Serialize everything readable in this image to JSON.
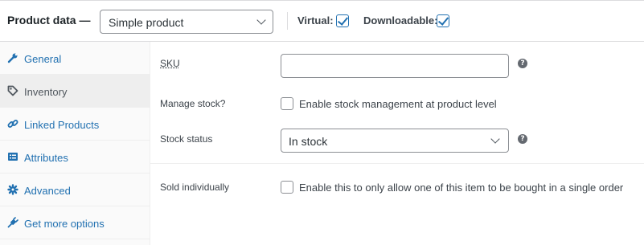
{
  "header": {
    "title": "Product data —",
    "product_type": {
      "selected": "Simple product"
    },
    "virtual": {
      "label": "Virtual:",
      "checked": true
    },
    "downloadable": {
      "label": "Downloadable:",
      "checked": true
    }
  },
  "tabs": [
    {
      "label": "General",
      "icon": "wrench-icon",
      "active": false
    },
    {
      "label": "Inventory",
      "icon": "tag-icon",
      "active": true
    },
    {
      "label": "Linked Products",
      "icon": "link-icon",
      "active": false
    },
    {
      "label": "Attributes",
      "icon": "list-icon",
      "active": false
    },
    {
      "label": "Advanced",
      "icon": "gear-icon",
      "active": false
    },
    {
      "label": "Get more options",
      "icon": "plug-icon",
      "active": false
    }
  ],
  "fields": {
    "sku": {
      "label": "SKU",
      "value": "",
      "help_icon": "?"
    },
    "manage_stock": {
      "label": "Manage stock?",
      "checkbox_text": "Enable stock management at product level",
      "checked": false
    },
    "stock_status": {
      "label": "Stock status",
      "selected": "In stock",
      "help_icon": "?"
    },
    "sold_individually": {
      "label": "Sold individually",
      "checkbox_text": "Enable this to only allow one of this item to be bought in a single order",
      "checked": false
    }
  },
  "colors": {
    "accent": "#2271b1",
    "sidebar_bg": "#fafafa",
    "active_tab_bg": "#eeeeee"
  }
}
